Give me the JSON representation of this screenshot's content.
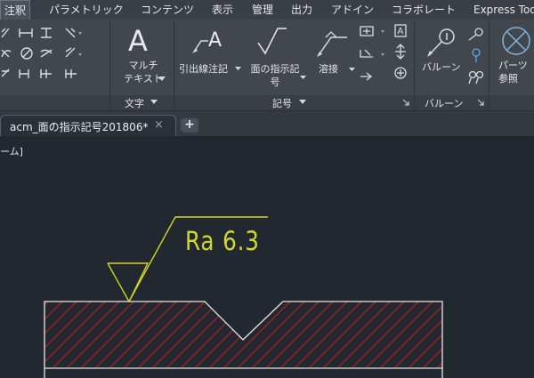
{
  "menubar": {
    "tabs": [
      {
        "label": "注釈",
        "active": true
      },
      {
        "label": "パラメトリック"
      },
      {
        "label": "コンテンツ"
      },
      {
        "label": "表示"
      },
      {
        "label": "管理"
      },
      {
        "label": "出力"
      },
      {
        "label": "アドイン"
      },
      {
        "label": "コラボレート"
      },
      {
        "label": "Express Tools"
      }
    ]
  },
  "ribbon": {
    "text_panel": {
      "title": "文字",
      "mtext_label": "マルチ\nテキスト"
    },
    "symbol_panel": {
      "title": "記号",
      "leader_label": "引出線注記",
      "surface_label": "面の指示記\n号",
      "weld_label": "溶接"
    },
    "balloon_panel": {
      "title": "バルーン",
      "balloon_label": "バルーン"
    },
    "parts_panel": {
      "parts_ref_label": "パーツ\n参照"
    }
  },
  "document": {
    "tab_label": "acm_面の指示記号201806*",
    "close_symbol": "×",
    "new_tab_symbol": "+"
  },
  "canvas": {
    "view_label": "ーム]",
    "roughness_text": "Ra 6.3"
  },
  "colors": {
    "background": "#212830",
    "annotation": "#d4d62a",
    "hatch": "#c41e1e",
    "part_outline": "#e8e8e8"
  }
}
